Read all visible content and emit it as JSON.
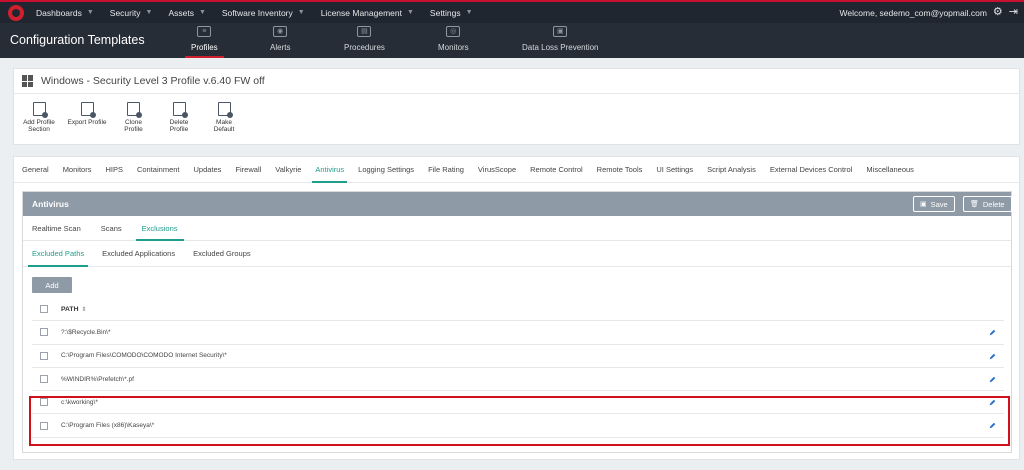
{
  "topnav": {
    "items": [
      {
        "label": "Dashboards"
      },
      {
        "label": "Security"
      },
      {
        "label": "Assets"
      },
      {
        "label": "Software Inventory"
      },
      {
        "label": "License Management"
      },
      {
        "label": "Settings"
      }
    ],
    "welcome": "Welcome, sedemo_com@yopmail.com"
  },
  "subheader": {
    "title": "Configuration Templates",
    "modules": [
      {
        "label": "Profiles",
        "active": true
      },
      {
        "label": "Alerts"
      },
      {
        "label": "Procedures"
      },
      {
        "label": "Monitors"
      },
      {
        "label": "Data Loss Prevention"
      }
    ]
  },
  "profile": {
    "title": "Windows - Security Level 3 Profile v.6.40 FW off",
    "actions": [
      {
        "label_line1": "Add Profile",
        "label_line2": "Section"
      },
      {
        "label_line1": "Export Profile",
        "label_line2": ""
      },
      {
        "label_line1": "Clone Profile",
        "label_line2": ""
      },
      {
        "label_line1": "Delete Profile",
        "label_line2": ""
      },
      {
        "label_line1": "Make Default",
        "label_line2": ""
      }
    ]
  },
  "tabs": [
    "General",
    "Monitors",
    "HIPS",
    "Containment",
    "Updates",
    "Firewall",
    "Valkyrie",
    "Antivirus",
    "Logging Settings",
    "File Rating",
    "VirusScope",
    "Remote Control",
    "Remote Tools",
    "UI Settings",
    "Script Analysis",
    "External Devices Control",
    "Miscellaneous"
  ],
  "active_tab": "Antivirus",
  "antivirus": {
    "title": "Antivirus",
    "save_label": "Save",
    "delete_label": "Delete",
    "subtabs": [
      "Realtime Scan",
      "Scans",
      "Exclusions"
    ],
    "exclusion_tabs": [
      "Excluded Paths",
      "Excluded Applications",
      "Excluded Groups"
    ],
    "add_label": "Add",
    "column_path": "PATH",
    "paths": [
      "?:\\$Recycle.Bin\\*",
      "C:\\Program Files\\COMODO\\COMODO Internet Security\\*",
      "%WINDIR%\\Prefetch\\*.pf",
      "c:\\kworking\\*",
      "C:\\Program Files (x86)\\Kaseya\\*"
    ]
  },
  "colors": {
    "topbar": "#1f2630",
    "accent_red": "#d0202d",
    "accent_teal": "#1f9e8c",
    "panel_header": "#8e9aa6",
    "edit_icon": "#2a6fc9"
  },
  "icons": [
    "comodo-logo-icon",
    "chevron-down-icon",
    "gear-icon",
    "logout-icon",
    "windows-icon",
    "pencil-icon",
    "save-icon",
    "trash-icon",
    "sort-icon"
  ]
}
